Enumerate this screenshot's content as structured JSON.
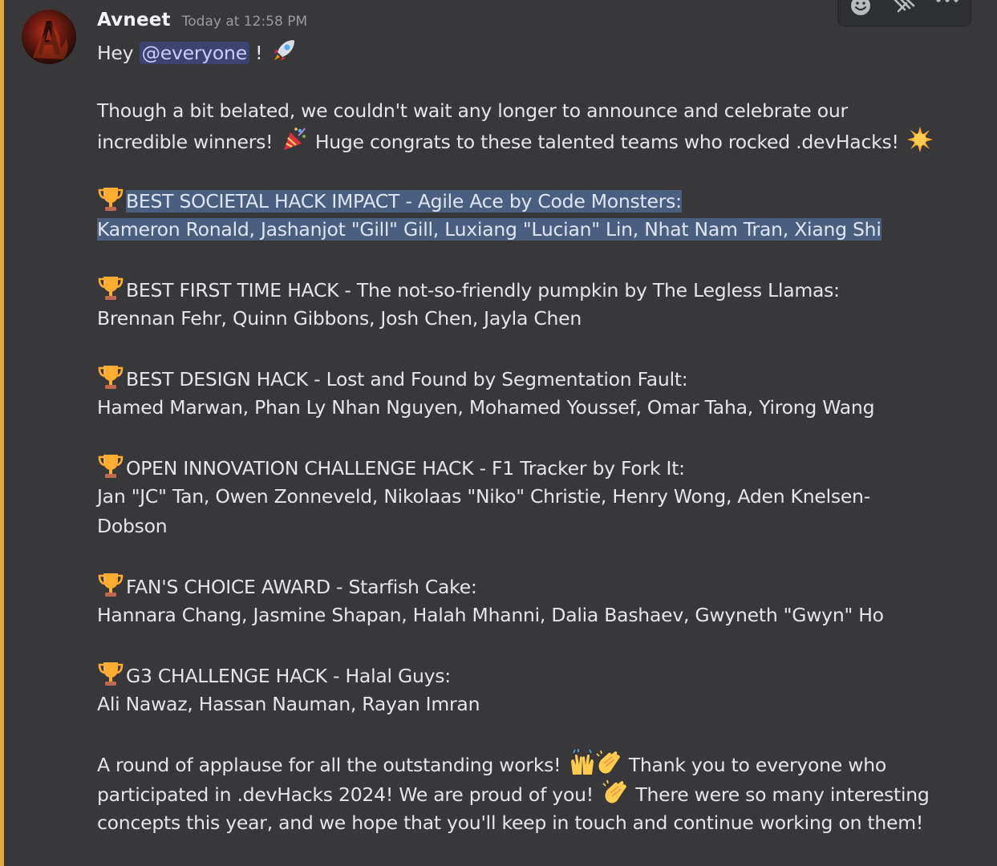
{
  "message": {
    "author": "Avneet",
    "timestamp": "Today at 12:58 PM",
    "greeting_prefix": "Hey",
    "mention": "@everyone",
    "greeting_suffix": "!",
    "intro_line1": "Though a bit belated, we couldn't wait any longer to announce and celebrate our",
    "intro_line2a": "incredible winners!",
    "intro_line2b": "Huge congrats to these talented teams who rocked .devHacks!",
    "awards": [
      {
        "title": "BEST SOCIETAL HACK IMPACT - Agile Ace by Code Monsters:",
        "members": "Kameron Ronald, Jashanjot \"Gill\" Gill, Luxiang \"Lucian\" Lin, Nhat Nam Tran, Xiang Shi"
      },
      {
        "title": "BEST FIRST TIME HACK - The not-so-friendly pumpkin by The Legless Llamas:",
        "members": "Brennan Fehr, Quinn Gibbons, Josh Chen, Jayla Chen"
      },
      {
        "title": "BEST DESIGN HACK - Lost and Found by Segmentation Fault:",
        "members": "Hamed Marwan, Phan Ly Nhan Nguyen, Mohamed Youssef, Omar Taha, Yirong Wang"
      },
      {
        "title": "OPEN INNOVATION CHALLENGE HACK - F1 Tracker by Fork It:",
        "members": "Jan \"JC\" Tan, Owen Zonneveld, Nikolaas \"Niko\" Christie, Henry Wong, Aden Knelsen-",
        "members_cont": "Dobson"
      },
      {
        "title": "FAN'S CHOICE AWARD - Starfish Cake:",
        "members": "Hannara Chang, Jasmine Shapan, Halah Mhanni, Dalia Bashaev, Gwyneth \"Gwyn\" Ho"
      },
      {
        "title": "G3 CHALLENGE HACK - Halal Guys:",
        "members": "Ali Nawaz, Hassan Nauman, Rayan Imran"
      }
    ],
    "outro_line1a": "A round of applause for all the outstanding works!",
    "outro_line1b": "Thank you to everyone who",
    "outro_line2a": "participated in .devHacks 2024!  We are proud of you!",
    "outro_line2b": "There were so many interesting",
    "outro_line3": "concepts this year, and we hope that you'll keep in touch and continue working on them!"
  },
  "toolbar": {
    "icons": [
      "add-reaction-icon",
      "quick-reactions-icon",
      "more-options-icon"
    ]
  },
  "colors": {
    "background": "#38383a",
    "accent_bar": "#e2a93b",
    "mention_bg": "#3d4270",
    "selection": "#4a5f80"
  }
}
